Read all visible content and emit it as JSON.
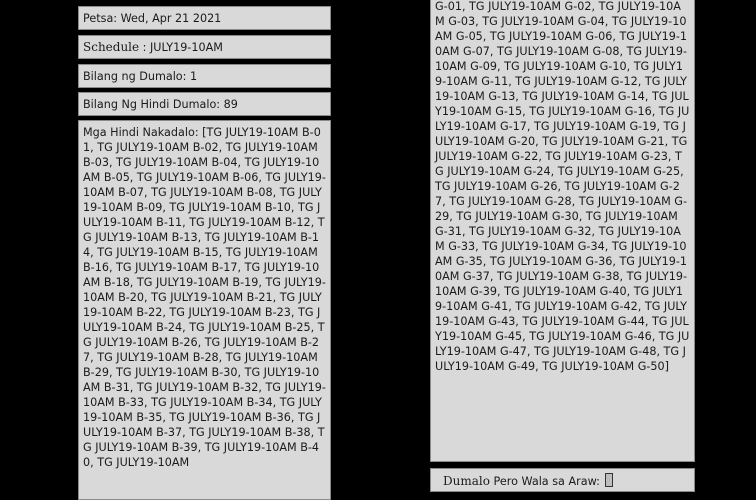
{
  "left": {
    "date_line": "Petsa: Wed, Apr 21 2021",
    "schedule_label": "Schedule",
    "schedule_value": " : JULY19-10AM",
    "present_count_line": "Bilang ng Dumalo: 1",
    "absent_count_line": "Bilang Ng Hindi Dumalo: 89",
    "absentees_text": "Mga Hindi Nakadalo: [TG JULY19-10AM B-01, TG JULY19-10AM B-02, TG JULY19-10AM B-03, TG JULY19-10AM B-04, TG JULY19-10AM B-05, TG JULY19-10AM B-06, TG JULY19-10AM B-07, TG JULY19-10AM B-08, TG JULY19-10AM B-09, TG JULY19-10AM B-10, TG JULY19-10AM B-11, TG JULY19-10AM B-12, TG JULY19-10AM B-13, TG JULY19-10AM B-14, TG JULY19-10AM B-15, TG JULY19-10AM B-16, TG JULY19-10AM B-17, TG JULY19-10AM B-18, TG JULY19-10AM B-19, TG JULY19-10AM B-20, TG JULY19-10AM B-21, TG JULY19-10AM B-22, TG JULY19-10AM B-23, TG JULY19-10AM B-24, TG JULY19-10AM B-25, TG JULY19-10AM B-26, TG JULY19-10AM B-27, TG JULY19-10AM B-28, TG JULY19-10AM B-29, TG JULY19-10AM B-30, TG JULY19-10AM B-31, TG JULY19-10AM B-32, TG JULY19-10AM B-33, TG JULY19-10AM B-34, TG JULY19-10AM B-35, TG JULY19-10AM B-36, TG JULY19-10AM B-37, TG JULY19-10AM B-38, TG JULY19-10AM B-39, TG JULY19-10AM B-40, TG JULY19-10AM"
  },
  "right": {
    "absentees_continued": "G-01, TG JULY19-10AM G-02, TG JULY19-10AM G-03, TG JULY19-10AM G-04, TG JULY19-10AM G-05, TG JULY19-10AM G-06, TG JULY19-10AM G-07, TG JULY19-10AM G-08, TG JULY19-10AM G-09, TG JULY19-10AM G-10, TG JULY19-10AM G-11, TG JULY19-10AM G-12, TG JULY19-10AM G-13, TG JULY19-10AM G-14, TG JULY19-10AM G-15, TG JULY19-10AM G-16, TG JULY19-10AM G-17, TG JULY19-10AM G-19, TG JULY19-10AM G-20, TG JULY19-10AM G-21, TG JULY19-10AM G-22, TG JULY19-10AM G-23, TG JULY19-10AM G-24, TG JULY19-10AM G-25, TG JULY19-10AM G-26, TG JULY19-10AM G-27, TG JULY19-10AM G-28, TG JULY19-10AM G-29, TG JULY19-10AM G-30, TG JULY19-10AM G-31, TG JULY19-10AM G-32, TG JULY19-10AM G-33, TG JULY19-10AM G-34, TG JULY19-10AM G-35, TG JULY19-10AM G-36, TG JULY19-10AM G-37, TG JULY19-10AM G-38, TG JULY19-10AM G-39, TG JULY19-10AM G-40, TG JULY19-10AM G-41, TG JULY19-10AM G-42, TG JULY19-10AM G-43, TG JULY19-10AM G-44, TG JULY19-10AM G-45, TG JULY19-10AM G-46, TG JULY19-10AM G-47, TG JULY19-10AM G-48, TG JULY19-10AM G-49, TG JULY19-10AM G-50]",
    "present_label": "Dumalo",
    "present_not_scheduled_text": " Pero Wala sa Araw: "
  }
}
